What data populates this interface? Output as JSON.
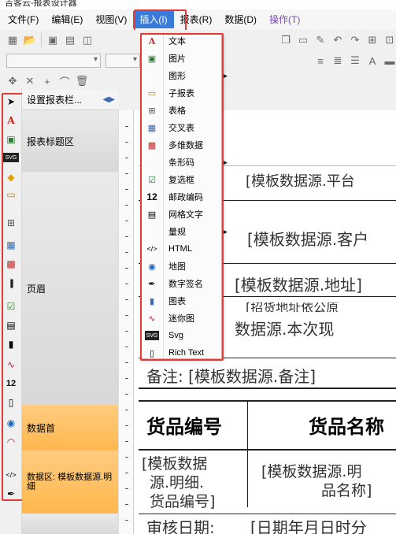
{
  "window": {
    "title": "吉客云-报表设计器"
  },
  "menubar": {
    "items": [
      {
        "id": "file",
        "label": "文件(F)"
      },
      {
        "id": "edit",
        "label": "编辑(E)"
      },
      {
        "id": "view",
        "label": "视图(V)"
      },
      {
        "id": "insert",
        "label": "插入(I)"
      },
      {
        "id": "report",
        "label": "报表(R)"
      },
      {
        "id": "data",
        "label": "数据(D)"
      },
      {
        "id": "action",
        "label": "操作(T)"
      }
    ]
  },
  "band_panel": {
    "header": "设置报表栏...",
    "bands": [
      {
        "label": "报表标题区"
      },
      {
        "label": "页眉"
      },
      {
        "label": "数据首"
      },
      {
        "label": "数据区: 模板数据源.明细"
      }
    ]
  },
  "insert_menu": {
    "items": [
      {
        "icon": "text-icon",
        "label": "文本",
        "submenu": false
      },
      {
        "icon": "image-icon",
        "label": "图片",
        "submenu": false
      },
      {
        "icon": "",
        "label": "图形",
        "submenu": true
      },
      {
        "icon": "subreport-icon",
        "label": "子报表",
        "submenu": false
      },
      {
        "icon": "table-icon",
        "label": "表格",
        "submenu": false
      },
      {
        "icon": "crosstab-icon",
        "label": "交叉表",
        "submenu": false
      },
      {
        "icon": "multidim-icon",
        "label": "多维数据",
        "submenu": false
      },
      {
        "icon": "",
        "label": "条形码",
        "submenu": true
      },
      {
        "icon": "checkbox-icon",
        "label": "复选框",
        "submenu": false
      },
      {
        "icon": "postcode-icon",
        "label": "邮政编码",
        "submenu": false
      },
      {
        "icon": "gridtext-icon",
        "label": "网格文字",
        "submenu": false
      },
      {
        "icon": "",
        "label": "量规",
        "submenu": true
      },
      {
        "icon": "html-icon",
        "label": "HTML",
        "submenu": false
      },
      {
        "icon": "map-icon",
        "label": "地图",
        "submenu": false
      },
      {
        "icon": "signature-icon",
        "label": "数字签名",
        "submenu": false
      },
      {
        "icon": "chart-icon",
        "label": "图表",
        "submenu": false
      },
      {
        "icon": "sparkline-icon",
        "label": "迷你图",
        "submenu": false
      },
      {
        "icon": "svg-icon",
        "label": "Svg",
        "submenu": false
      },
      {
        "icon": "richtext-icon",
        "label": "Rich Text",
        "submenu": false
      }
    ]
  },
  "canvas": {
    "fields": [
      "[模板数据源.平台",
      "[模板数据源.客户",
      "[模板数据源.地址]",
      "[招货地址依公原",
      "数据源.本次现",
      "备注: [模板数据源.备注]",
      "货品编号",
      "货品名称",
      "[模板数据",
      "源.明细.",
      "货品编号]",
      "[模板数据源.明",
      "品名称]",
      "审核日期:",
      "[日期年月日时分"
    ]
  },
  "colors": {
    "accent": "#3a7ad8",
    "highlight": "#e53935",
    "band_orange": "#ffb74d"
  }
}
